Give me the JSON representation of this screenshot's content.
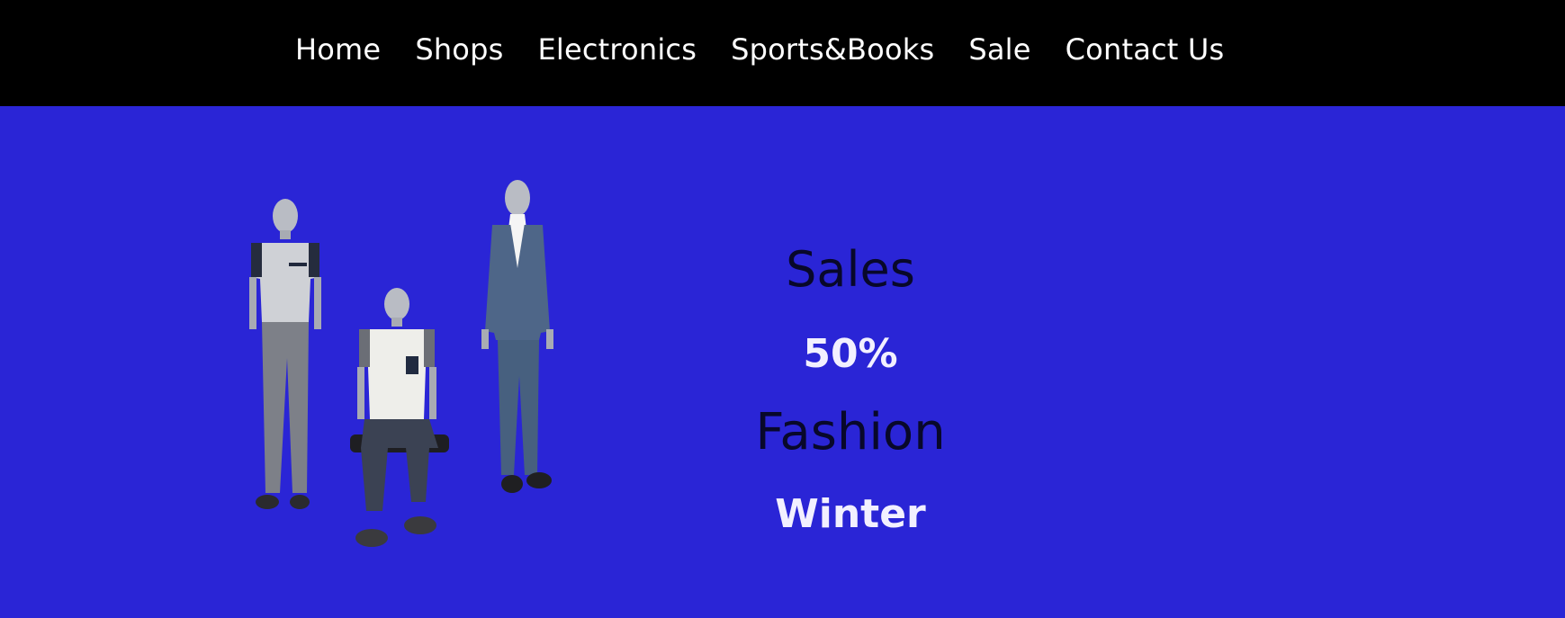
{
  "nav": {
    "items": [
      {
        "label": "Home"
      },
      {
        "label": "Shops"
      },
      {
        "label": "Electronics"
      },
      {
        "label": "Sports&Books"
      },
      {
        "label": "Sale"
      },
      {
        "label": "Contact Us"
      }
    ]
  },
  "hero": {
    "image": "mannequins-image",
    "promo": {
      "line1": "Sales",
      "line2": "50%",
      "line3": "Fashion",
      "line4": "Winter"
    }
  },
  "colors": {
    "nav_background": "#000000",
    "hero_background": "#2a25d6",
    "dark_text": "#08082a",
    "light_text": "#f2f0ff"
  }
}
